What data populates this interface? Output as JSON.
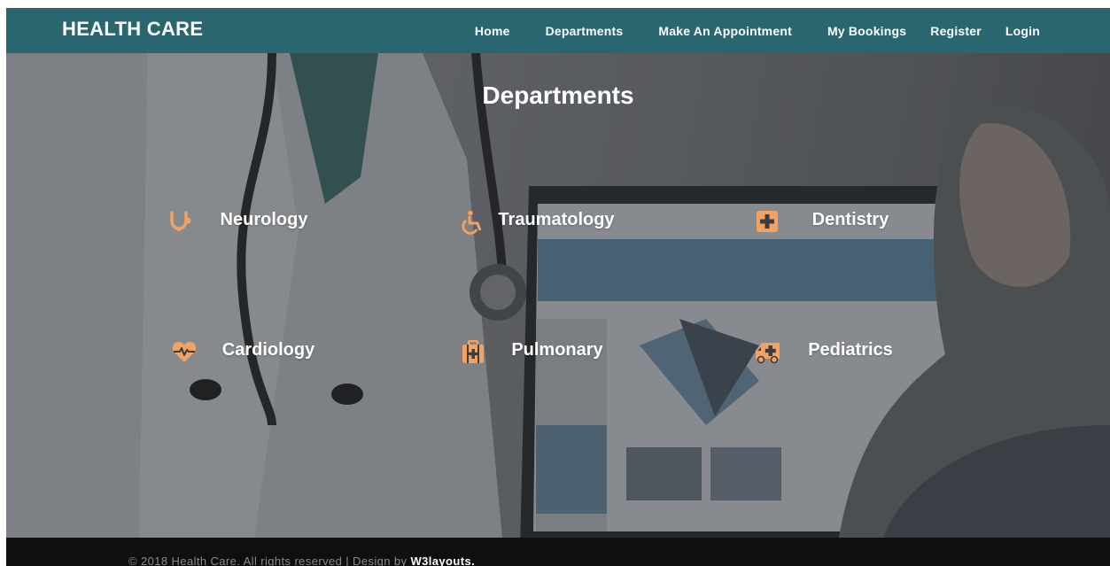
{
  "brand": "HEALTH CARE",
  "nav": {
    "home": "Home",
    "departments": "Departments",
    "appointment": "Make An Appointment",
    "bookings": "My Bookings",
    "register": "Register",
    "login": "Login"
  },
  "hero": {
    "title": "Departments"
  },
  "departments": [
    {
      "label": "Neurology",
      "icon": "stethoscope-icon"
    },
    {
      "label": "Traumatology",
      "icon": "wheelchair-icon"
    },
    {
      "label": "Dentistry",
      "icon": "medical-plus-icon"
    },
    {
      "label": "Cardiology",
      "icon": "heartbeat-icon"
    },
    {
      "label": "Pulmonary",
      "icon": "medkit-icon"
    },
    {
      "label": "Pediatrics",
      "icon": "ambulance-icon"
    }
  ],
  "footer": {
    "text": "© 2018 Health Care. All rights reserved | Design by ",
    "link": "W3layouts."
  },
  "colors": {
    "navbar": "#2a6670",
    "icon_accent": "#f4a261",
    "footer": "#0f0f10"
  }
}
